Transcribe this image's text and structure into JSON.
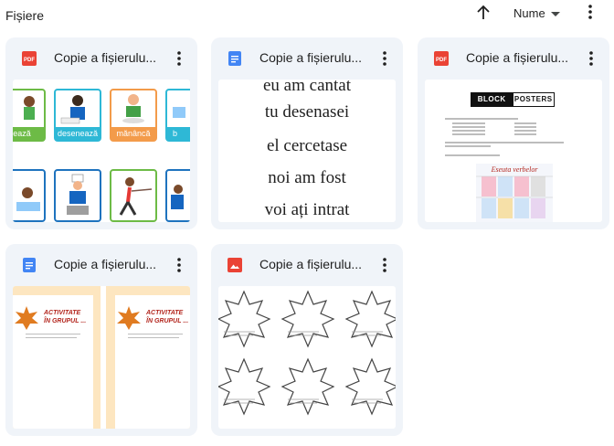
{
  "header": {
    "title": "Fișiere",
    "sort_label": "Nume"
  },
  "colors": {
    "pdf": "#ea4335",
    "doc": "#4285f4",
    "image": "#ea4335",
    "card_bg": "#f0f4f9"
  },
  "cards": [
    {
      "title": "Copie a fișierulu...",
      "type_icon": "pdf-icon",
      "thumb": {
        "captions": [
          "ează",
          "desenează",
          "mănâncă",
          "b"
        ]
      }
    },
    {
      "title": "Copie a fișierulu...",
      "type_icon": "doc-icon",
      "thumb": {
        "lines": [
          "eu am cantat",
          "tu desenasei",
          "el cercetase",
          "noi am fost",
          "voi ați intrat"
        ]
      }
    },
    {
      "title": "Copie a fișierulu...",
      "type_icon": "pdf-icon",
      "thumb": {
        "logo_left": "BLOCK",
        "logo_right": "POSTERS",
        "poster_title": "Eseuta verbelor"
      }
    },
    {
      "title": "Copie a fișierulu...",
      "type_icon": "doc-icon",
      "thumb": {
        "heading_1": "ACTIVITATE",
        "heading_2": "ÎN GRUPUL ..."
      }
    },
    {
      "title": "Copie a fișierulu...",
      "type_icon": "image-icon",
      "thumb": {}
    }
  ]
}
